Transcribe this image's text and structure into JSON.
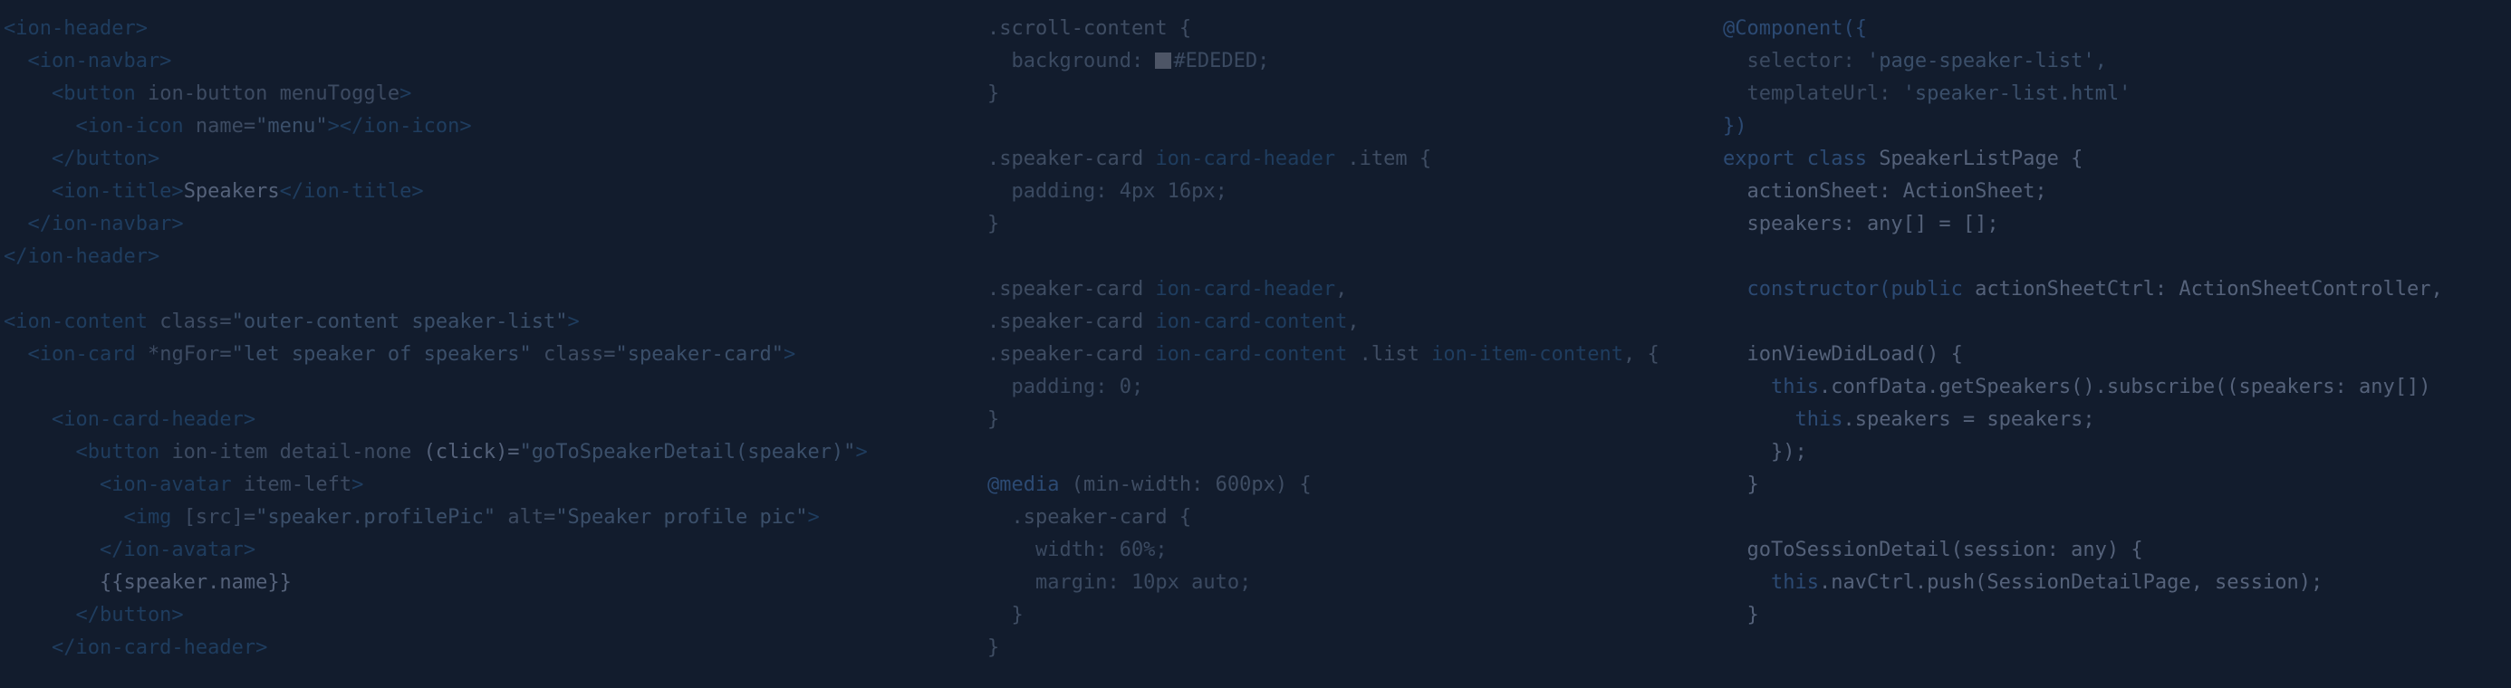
{
  "html_code": {
    "lines": [
      [
        [
          "tag",
          "<ion-header>"
        ]
      ],
      [
        [
          "tag",
          "  <ion-navbar>"
        ]
      ],
      [
        [
          "tag",
          "    <button "
        ],
        [
          "attr",
          "ion-button menuToggle"
        ],
        [
          "tag",
          ">"
        ]
      ],
      [
        [
          "tag",
          "      <ion-icon "
        ],
        [
          "attr",
          "name="
        ],
        [
          "str",
          "\"menu\""
        ],
        [
          "tag",
          "></ion-icon>"
        ]
      ],
      [
        [
          "tag",
          "    </button>"
        ]
      ],
      [
        [
          "tag",
          "    <ion-title>"
        ],
        [
          "txt",
          "Speakers"
        ],
        [
          "tag",
          "</ion-title>"
        ]
      ],
      [
        [
          "tag",
          "  </ion-navbar>"
        ]
      ],
      [
        [
          "tag",
          "</ion-header>"
        ]
      ],
      [],
      [
        [
          "tag",
          "<ion-content "
        ],
        [
          "attr",
          "class="
        ],
        [
          "str",
          "\"outer-content speaker-list\""
        ],
        [
          "tag",
          ">"
        ]
      ],
      [
        [
          "tag",
          "  <ion-card "
        ],
        [
          "attr",
          "*ngFor="
        ],
        [
          "str",
          "\"let speaker of speakers\""
        ],
        [
          "attr",
          " class="
        ],
        [
          "str",
          "\"speaker-card\""
        ],
        [
          "tag",
          ">"
        ]
      ],
      [],
      [
        [
          "tag",
          "    <ion-card-header>"
        ]
      ],
      [
        [
          "tag",
          "      <button "
        ],
        [
          "attr",
          "ion-item detail-none "
        ],
        [
          "txt",
          "(click)="
        ],
        [
          "str",
          "\"goToSpeakerDetail(speaker)\""
        ],
        [
          "tag",
          ">"
        ]
      ],
      [
        [
          "tag",
          "        <ion-avatar "
        ],
        [
          "attr",
          "item-left"
        ],
        [
          "tag",
          ">"
        ]
      ],
      [
        [
          "tag",
          "          <img "
        ],
        [
          "attr",
          "[src]="
        ],
        [
          "str",
          "\"speaker.profilePic\""
        ],
        [
          "attr",
          " alt="
        ],
        [
          "str",
          "\"Speaker profile pic\""
        ],
        [
          "tag",
          ">"
        ]
      ],
      [
        [
          "tag",
          "        </ion-avatar>"
        ]
      ],
      [
        [
          "txt",
          "        {{speaker.name}}"
        ]
      ],
      [
        [
          "tag",
          "      </button>"
        ]
      ],
      [
        [
          "tag",
          "    </ion-card-header>"
        ]
      ]
    ]
  },
  "css_code": {
    "lines": [
      [
        [
          "sel",
          ".scroll-content {"
        ]
      ],
      [
        [
          "prop",
          "  background: "
        ],
        [
          "swatch",
          ""
        ],
        [
          "prop",
          "#EDEDED;"
        ]
      ],
      [
        [
          "sel",
          "}"
        ]
      ],
      [],
      [
        [
          "sel",
          ".speaker-card "
        ],
        [
          "tag",
          "ion-card-header"
        ],
        [
          "sel",
          " .item {"
        ]
      ],
      [
        [
          "prop",
          "  padding: 4px 16px;"
        ]
      ],
      [
        [
          "sel",
          "}"
        ]
      ],
      [],
      [
        [
          "sel",
          ".speaker-card "
        ],
        [
          "tag",
          "ion-card-header"
        ],
        [
          "sel",
          ","
        ]
      ],
      [
        [
          "sel",
          ".speaker-card "
        ],
        [
          "tag",
          "ion-card-content"
        ],
        [
          "sel",
          ","
        ]
      ],
      [
        [
          "sel",
          ".speaker-card "
        ],
        [
          "tag",
          "ion-card-content"
        ],
        [
          "sel",
          " .list "
        ],
        [
          "tag",
          "ion-item-content"
        ],
        [
          "sel",
          ", {"
        ]
      ],
      [
        [
          "prop",
          "  padding: 0;"
        ]
      ],
      [
        [
          "sel",
          "}"
        ]
      ],
      [],
      [
        [
          "kw",
          "@media"
        ],
        [
          "sel",
          " (min-width: 600px) {"
        ]
      ],
      [
        [
          "sel",
          "  .speaker-card {"
        ]
      ],
      [
        [
          "prop",
          "    width: 60%;"
        ]
      ],
      [
        [
          "prop",
          "    margin: 10px auto;"
        ]
      ],
      [
        [
          "sel",
          "  }"
        ]
      ],
      [
        [
          "sel",
          "}"
        ]
      ]
    ]
  },
  "ts_code": {
    "lines": [
      [
        [
          "kw",
          "@Component({"
        ]
      ],
      [
        [
          "prop",
          "  selector: "
        ],
        [
          "str",
          "'page-speaker-list',"
        ]
      ],
      [
        [
          "prop",
          "  templateUrl: "
        ],
        [
          "str",
          "'speaker-list.html'"
        ]
      ],
      [
        [
          "kw",
          "})"
        ]
      ],
      [
        [
          "kw",
          "export class "
        ],
        [
          "txt",
          "SpeakerListPage {"
        ]
      ],
      [
        [
          "txt",
          "  actionSheet: ActionSheet;"
        ]
      ],
      [
        [
          "txt",
          "  speakers: any[] = [];"
        ]
      ],
      [],
      [
        [
          "kw",
          "  constructor("
        ],
        [
          "kw",
          "public "
        ],
        [
          "txt",
          "actionSheetCtrl: ActionSheetController,"
        ]
      ],
      [],
      [
        [
          "txt",
          "  ionViewDidLoad() {"
        ]
      ],
      [
        [
          "kw",
          "    this"
        ],
        [
          "txt",
          ".confData.getSpeakers().subscribe((speakers: any[])"
        ]
      ],
      [
        [
          "kw",
          "      this"
        ],
        [
          "txt",
          ".speakers = speakers;"
        ]
      ],
      [
        [
          "txt",
          "    });"
        ]
      ],
      [
        [
          "txt",
          "  }"
        ]
      ],
      [],
      [
        [
          "txt",
          "  goToSessionDetail(session: any) {"
        ]
      ],
      [
        [
          "kw",
          "    this"
        ],
        [
          "txt",
          ".navCtrl.push(SessionDetailPage, session);"
        ]
      ],
      [
        [
          "txt",
          "  }"
        ]
      ]
    ]
  }
}
